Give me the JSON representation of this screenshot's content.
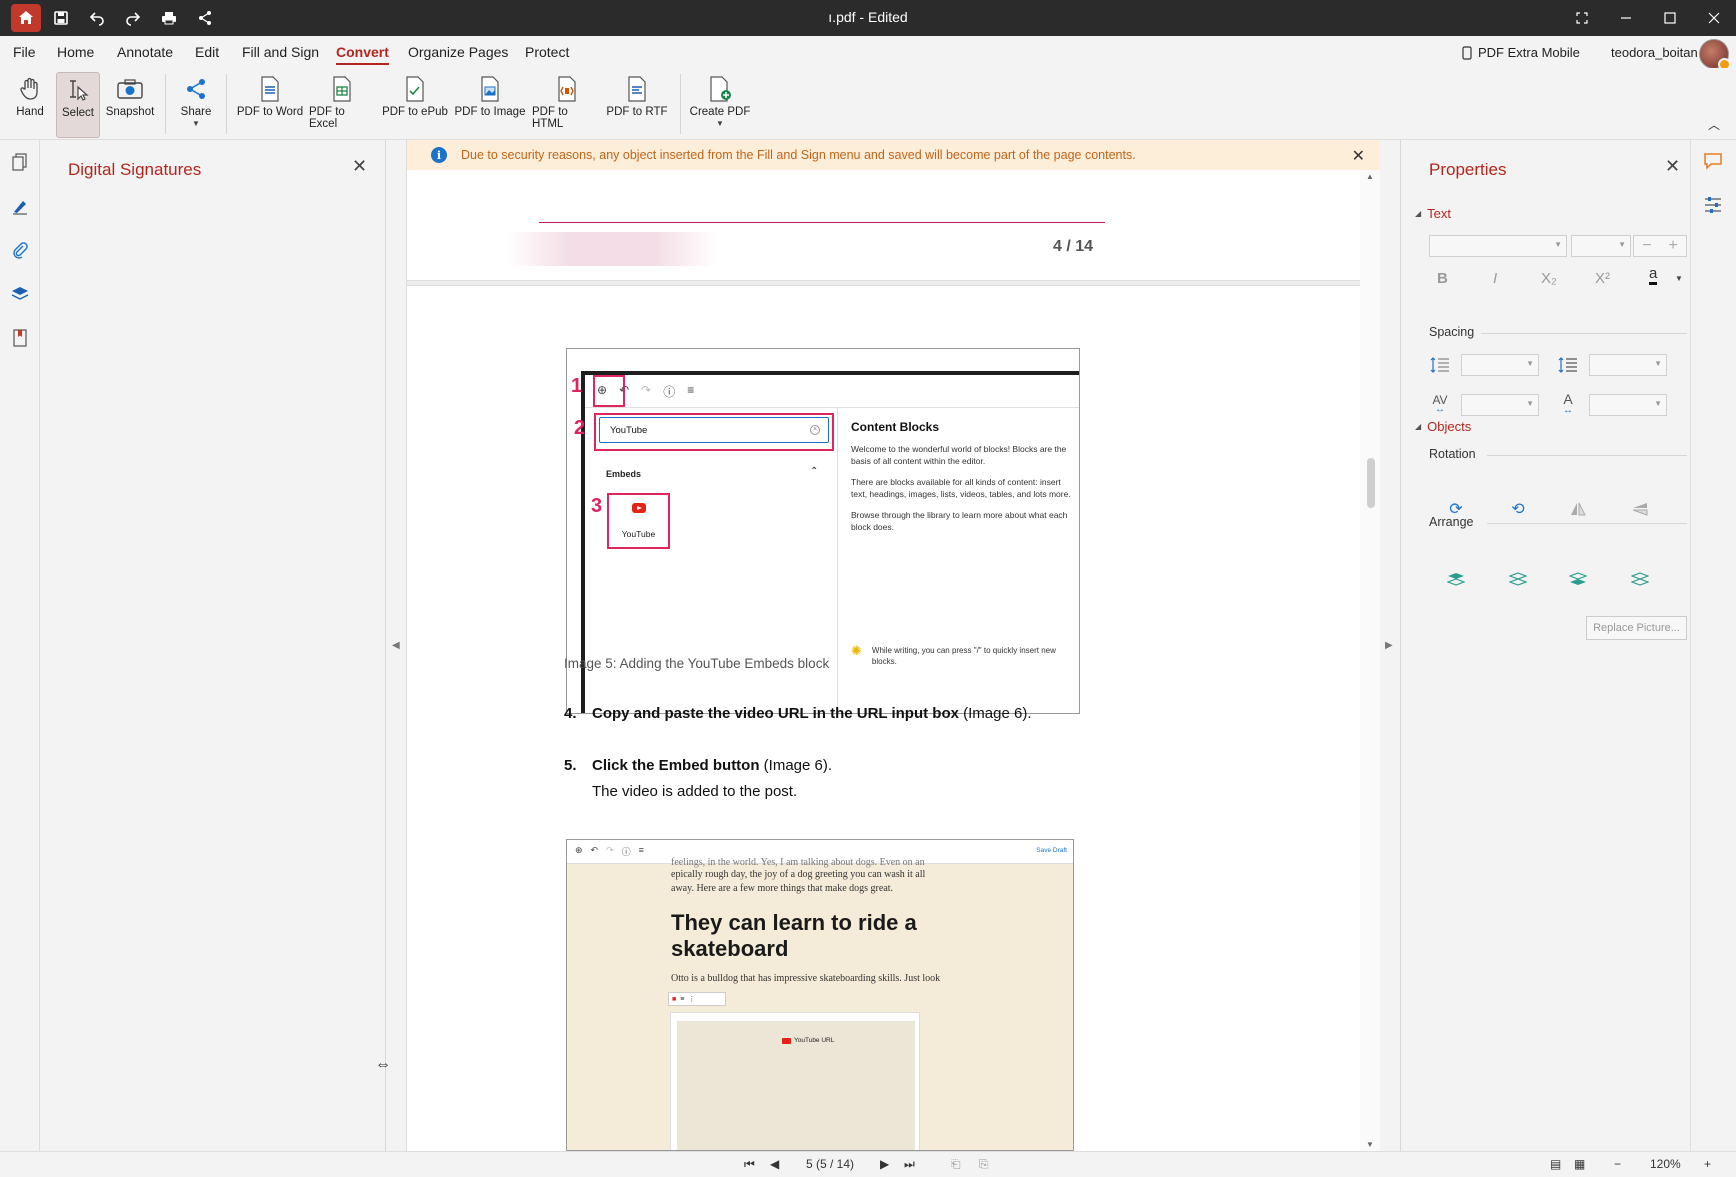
{
  "titlebar": {
    "title": "ı.pdf - Edited",
    "icons": [
      "home-icon",
      "save-icon",
      "undo-icon",
      "redo-icon",
      "print-icon",
      "share-icon"
    ],
    "window_buttons": [
      "fullscreen-icon",
      "minimize-icon",
      "maximize-icon",
      "close-icon"
    ]
  },
  "menu": {
    "items": [
      "File",
      "Home",
      "Annotate",
      "Edit",
      "Fill and Sign",
      "Convert",
      "Organize Pages",
      "Protect"
    ],
    "active": "Convert",
    "mobile_label": "PDF Extra Mobile",
    "username": "teodora_boitan"
  },
  "ribbon": {
    "hand": "Hand",
    "select": "Select",
    "snapshot": "Snapshot",
    "share": "Share",
    "pdf_to_word": "PDF to Word",
    "pdf_to_excel": "PDF to Excel",
    "pdf_to_epub": "PDF to ePub",
    "pdf_to_image": "PDF to Image",
    "pdf_to_html": "PDF to HTML",
    "pdf_to_rtf": "PDF to RTF",
    "create_pdf": "Create PDF"
  },
  "left_panel": {
    "title": "Digital Signatures"
  },
  "notice": {
    "text": "Due to security reasons, any object inserted from the Fill and Sign menu and saved will become part of the page contents."
  },
  "document": {
    "prev_page_number": "4 / 14",
    "shot1": {
      "marks": [
        "1",
        "2",
        "3"
      ],
      "search_value": "YouTube",
      "embeds_label": "Embeds",
      "youtube_label": "YouTube",
      "panel_title": "Content Blocks",
      "para1": "Welcome to the wonderful world of blocks! Blocks are the basis of all content within the editor.",
      "para2": "There are blocks available for all kinds of content: insert text, headings, images, lists, videos, tables, and lots more.",
      "para3": "Browse through the library to learn more about what each block does.",
      "tip": "While writing, you can press \"/\" to quickly insert new blocks."
    },
    "caption": "Image 5: Adding the YouTube Embeds block",
    "step4": {
      "num": "4.",
      "bold": "Copy and paste the video URL in the URL input box",
      "rest": " (Image 6)."
    },
    "step5": {
      "num": "5.",
      "bold": "Click the Embed button",
      "rest": " (Image 6).",
      "sub": "The video is added to the post."
    },
    "shot2": {
      "save_draft": "Save Draft",
      "text_top": "feelings, in the world. Yes, I am talking about dogs. Even on an",
      "text_line2": "epically rough day, the joy of a dog greeting you can wash it all",
      "text_line3": "away. Here are a few more things that make dogs great.",
      "heading_line1": "They can learn to ride a",
      "heading_line2": "skateboard",
      "para": "Otto is a bulldog that has impressive skateboarding skills. Just look",
      "youtube_url": "YouTube URL"
    }
  },
  "properties": {
    "title": "Properties",
    "text_section": "Text",
    "spacing_label": "Spacing",
    "objects_section": "Objects",
    "rotation_label": "Rotation",
    "arrange_label": "Arrange",
    "replace_picture": "Replace Picture...",
    "format_buttons": [
      "B",
      "I",
      "X₂",
      "X²",
      "a"
    ]
  },
  "status": {
    "page_indicator": "5 (5 / 14)",
    "zoom": "120%"
  },
  "colors": {
    "accent": "#b3261e",
    "notice_bg": "#fdeed9",
    "notice_text": "#c0651a",
    "highlight": "#e0245e"
  }
}
